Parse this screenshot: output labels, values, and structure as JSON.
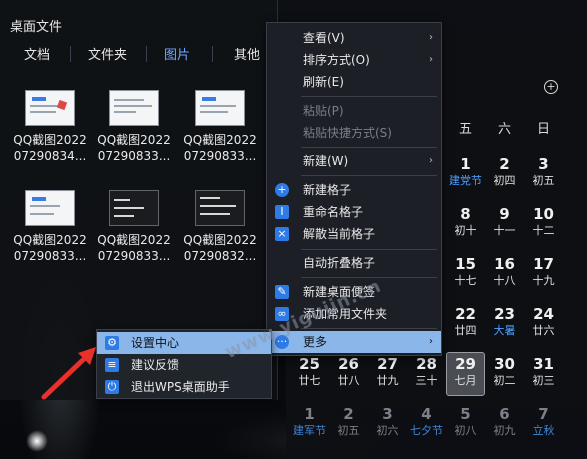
{
  "panel": {
    "title": "桌面文件",
    "tabs": [
      "文档",
      "文件夹",
      "图片",
      "其他"
    ],
    "files": [
      {
        "name": "QQ截图2022\n07290834..."
      },
      {
        "name": "QQ截图2022\n07290833..."
      },
      {
        "name": "QQ截图2022\n07290833..."
      },
      {
        "name": "QQ截图2022\n07290833..."
      },
      {
        "name": "QQ截图2022\n07290833..."
      },
      {
        "name": "QQ截图2022\n07290832..."
      }
    ]
  },
  "calendar": {
    "weekdays": [
      "五",
      "六",
      "日"
    ],
    "add_icon": "plus-circle-icon",
    "rows": [
      [
        {
          "n": "1",
          "s": "建党节",
          "blue": true
        },
        {
          "n": "2",
          "s": "初四"
        },
        {
          "n": "3",
          "s": "初五"
        }
      ],
      [
        {
          "n": "8",
          "s": "初十"
        },
        {
          "n": "9",
          "s": "十一"
        },
        {
          "n": "10",
          "s": "十二"
        }
      ],
      [
        {
          "n": "15",
          "s": "十七"
        },
        {
          "n": "16",
          "s": "十八"
        },
        {
          "n": "17",
          "s": "十九"
        }
      ],
      [
        {
          "n": "22",
          "s": "廿四"
        },
        {
          "n": "23",
          "s": "大暑",
          "blue": true
        },
        {
          "n": "24",
          "s": "廿六"
        }
      ],
      [
        {
          "n": "25",
          "s": "廿七"
        },
        {
          "n": "26",
          "s": "廿八"
        },
        {
          "n": "27",
          "s": "廿九"
        },
        {
          "n": "28",
          "s": "三十"
        },
        {
          "n": "29",
          "s": "七月",
          "today": true
        },
        {
          "n": "30",
          "s": "初二"
        },
        {
          "n": "31",
          "s": "初三"
        }
      ],
      [
        {
          "n": "1",
          "s": "建军节",
          "blue": true,
          "dim": true
        },
        {
          "n": "2",
          "s": "初五",
          "dim": true
        },
        {
          "n": "3",
          "s": "初六",
          "dim": true
        },
        {
          "n": "4",
          "s": "七夕节",
          "blue": true,
          "dim": true
        },
        {
          "n": "5",
          "s": "初八",
          "dim": true
        },
        {
          "n": "6",
          "s": "初九",
          "dim": true
        },
        {
          "n": "7",
          "s": "立秋",
          "blue": true,
          "dim": true
        }
      ]
    ]
  },
  "context_menu": {
    "items": [
      {
        "label": "查看(V)",
        "arrow": "›"
      },
      {
        "label": "排序方式(O)",
        "arrow": "›"
      },
      {
        "label": "刷新(E)"
      },
      {
        "label": "粘贴(P)",
        "disabled": true
      },
      {
        "label": "粘贴快捷方式(S)",
        "disabled": true
      },
      {
        "label": "新建(W)",
        "arrow": "›"
      },
      {
        "label": "新建格子",
        "icon": "plus-icon"
      },
      {
        "label": "重命名格子",
        "icon": "rename-icon"
      },
      {
        "label": "解散当前格子",
        "icon": "close-icon"
      },
      {
        "label": "自动折叠格子"
      },
      {
        "label": "新建桌面便签",
        "icon": "feather-icon"
      },
      {
        "label": "添加常用文件夹",
        "icon": "folder-link-icon"
      },
      {
        "label": "更多",
        "icon": "more-icon",
        "arrow": "›"
      }
    ]
  },
  "submenu": {
    "items": [
      {
        "label": "设置中心",
        "icon": "gear-icon"
      },
      {
        "label": "建议反馈",
        "icon": "feedback-icon"
      },
      {
        "label": "退出WPS桌面助手",
        "icon": "exit-icon"
      }
    ]
  },
  "watermark": "www.yigujin.cn"
}
